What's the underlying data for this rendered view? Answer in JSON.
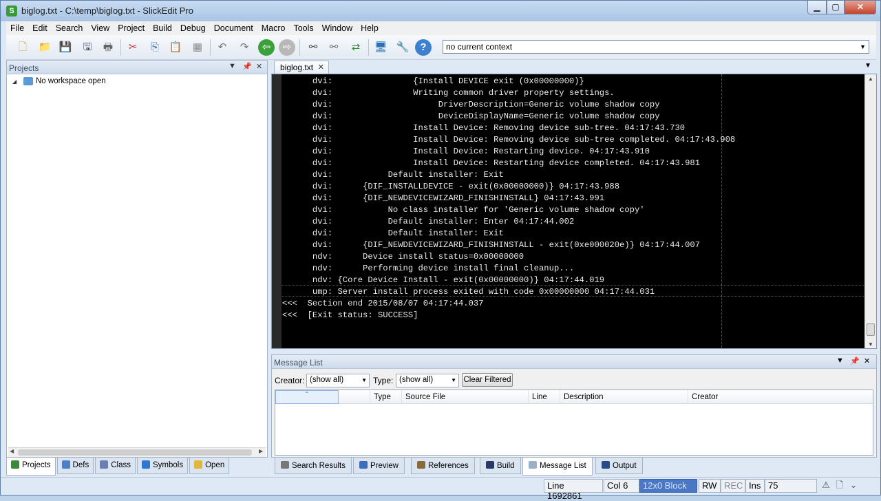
{
  "window": {
    "title": "biglog.txt - C:\\temp\\biglog.txt - SlickEdit Pro",
    "app_icon_letter": "S"
  },
  "menu": [
    "File",
    "Edit",
    "Search",
    "View",
    "Project",
    "Build",
    "Debug",
    "Document",
    "Macro",
    "Tools",
    "Window",
    "Help"
  ],
  "toolbar": {
    "context": "no current context"
  },
  "projects_panel": {
    "title": "Projects",
    "tree_root": "No workspace open"
  },
  "left_tabs": [
    "Projects",
    "Defs",
    "Class",
    "Symbols",
    "Open"
  ],
  "editor": {
    "tab": "biglog.txt",
    "lines": [
      "      dvi:                {Install DEVICE exit (0x00000000)}",
      "      dvi:                Writing common driver property settings.",
      "      dvi:                     DriverDescription=Generic volume shadow copy",
      "      dvi:                     DeviceDisplayName=Generic volume shadow copy",
      "      dvi:                Install Device: Removing device sub-tree. 04:17:43.730",
      "      dvi:                Install Device: Removing device sub-tree completed. 04:17:43.908",
      "      dvi:                Install Device: Restarting device. 04:17:43.910",
      "      dvi:                Install Device: Restarting device completed. 04:17:43.981",
      "      dvi:           Default installer: Exit",
      "      dvi:      {DIF_INSTALLDEVICE - exit(0x00000000)} 04:17:43.988",
      "      dvi:      {DIF_NEWDEVICEWIZARD_FINISHINSTALL} 04:17:43.991",
      "      dvi:           No class installer for 'Generic volume shadow copy'",
      "      dvi:           Default installer: Enter 04:17:44.002",
      "      dvi:           Default installer: Exit",
      "      dvi:      {DIF_NEWDEVICEWIZARD_FINISHINSTALL - exit(0xe000020e)} 04:17:44.007",
      "      ndv:      Device install status=0x00000000",
      "      ndv:      Performing device install final cleanup...",
      "      ndv: {Core Device Install - exit(0x00000000)} 04:17:44.019",
      "      ump: Server install process exited with code 0x00000000 04:17:44.031",
      "<<<  Section end 2015/08/07 04:17:44.037",
      "<<<  [Exit status: SUCCESS]"
    ]
  },
  "message_list": {
    "title": "Message List",
    "creator_label": "Creator:",
    "creator_value": "(show all)",
    "type_label": "Type:",
    "type_value": "(show all)",
    "clear_button": "Clear Filtered",
    "columns": [
      "Type",
      "Source File",
      "Line",
      "Description",
      "Creator"
    ]
  },
  "bottom_tabs": [
    "Search Results",
    "Preview",
    "References",
    "Build",
    "Message List",
    "Output"
  ],
  "status": {
    "line": "Line 1692861",
    "col": "Col 6",
    "block": "12x0 Block",
    "rw": "RW",
    "rec": "REC",
    "ins": "Ins",
    "num": "75"
  }
}
